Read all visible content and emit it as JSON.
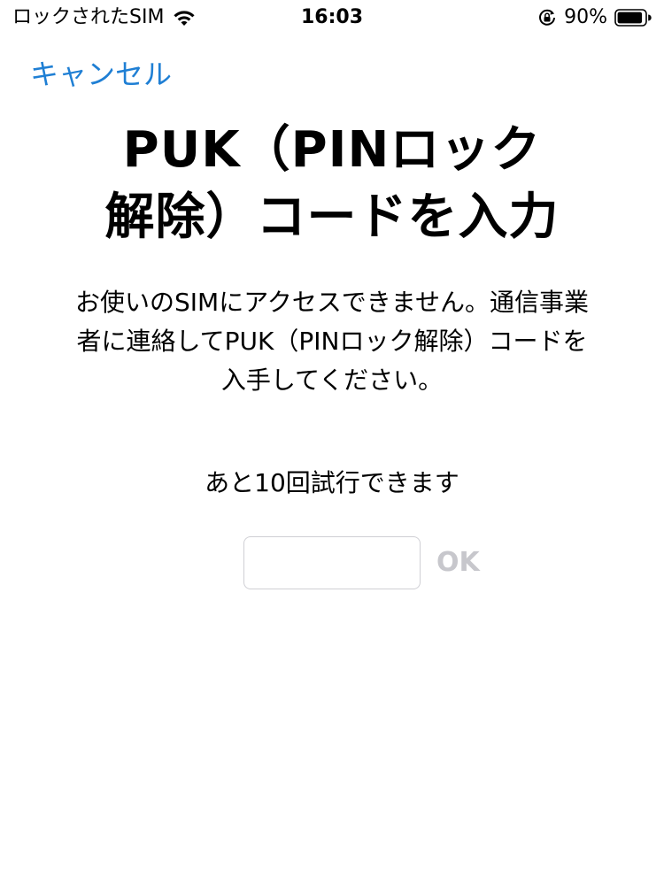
{
  "status_bar": {
    "carrier": "ロックされたSIM",
    "time": "16:03",
    "battery": "90%",
    "icons": [
      "wifi-icon",
      "lock-rotation-icon",
      "battery-icon"
    ]
  },
  "nav": {
    "cancel_label": "キャンセル"
  },
  "title_lines": [
    "PUK（PINロック",
    "解除）コードを入力"
  ],
  "description_lines": [
    "お使いのSIMにアクセスできません。通信事業",
    "者に連絡してPUK（PINロック解除）コードを",
    "入手してください。"
  ],
  "attempts_text": "あと10回試行できます",
  "input": {
    "value": "",
    "placeholder": ""
  },
  "ok_label": "OK",
  "colors": {
    "link": "#1f7fd4",
    "disabled": "#c7c7cc",
    "input_border": "#cfcfd4"
  }
}
